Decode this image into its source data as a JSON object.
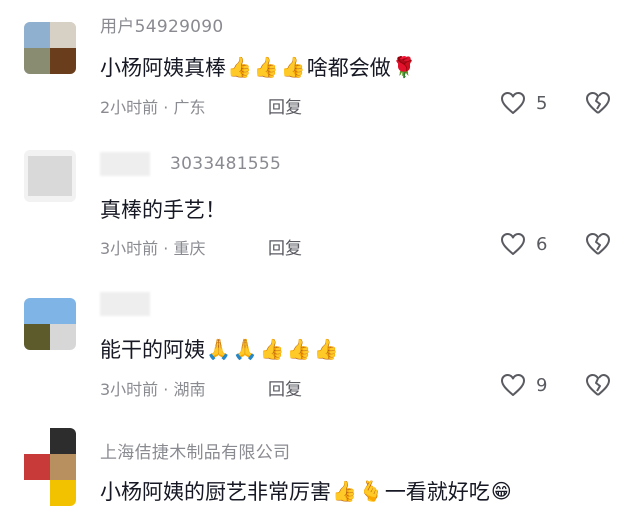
{
  "comments": [
    {
      "username": "用户54929090",
      "text": "小杨阿姨真棒",
      "emojis_after": [
        "👍",
        "👍",
        "👍"
      ],
      "text2": "啥都会做",
      "emoji_end": "🌹",
      "time": "2小时前 · 广东",
      "reply": "回复",
      "likes": "5"
    },
    {
      "username": "3033481555",
      "text": "真棒的手艺！",
      "time": "3小时前 · 重庆",
      "reply": "回复",
      "likes": "6"
    },
    {
      "username": "",
      "text": "能干的阿姨",
      "emojis_after": [
        "🙏",
        "🙏",
        "👍",
        "👍",
        "👍"
      ],
      "time": "3小时前 · 湖南",
      "reply": "回复",
      "likes": "9"
    },
    {
      "username": "上海佶捷木制品有限公司",
      "text": "小杨阿姨的厨艺非常厉害",
      "emojis_after": [
        "👍",
        "🫰"
      ],
      "text2": "一看就好吃",
      "emoji_end": "😁"
    }
  ],
  "icons": {
    "like": "heart-outline-icon",
    "dislike": "broken-heart-icon"
  },
  "colors": {
    "text_primary": "#161823",
    "text_secondary": "#8a8b91",
    "reply": "#5a5b61"
  }
}
